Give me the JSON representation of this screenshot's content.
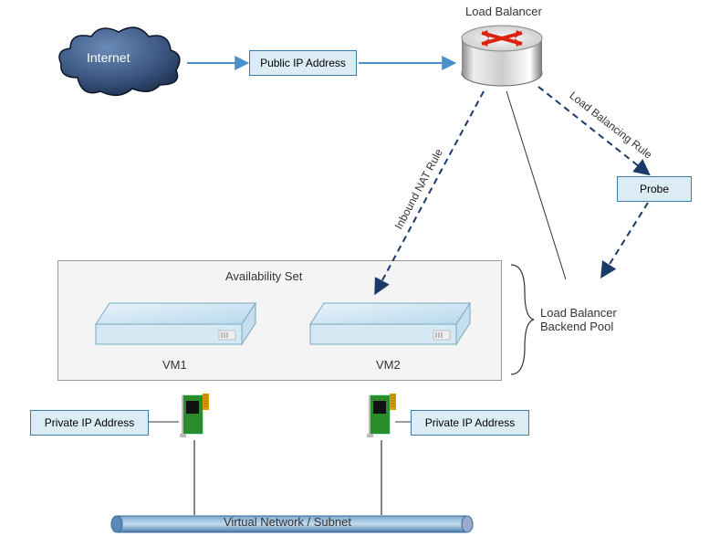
{
  "nodes": {
    "internet": "Internet",
    "public_ip": "Public IP Address",
    "load_balancer": "Load Balancer",
    "probe": "Probe",
    "availability_set": "Availability Set",
    "vm1": "VM1",
    "vm2": "VM2",
    "private_ip_left": "Private IP Address",
    "private_ip_right": "Private IP Address",
    "vnet": "Virtual Network / Subnet"
  },
  "edges": {
    "inbound_nat": "Inbound NAT Rule",
    "lb_rule": "Load Balancing Rule",
    "lb_backend": "Load Balancer\nBackend Pool"
  }
}
